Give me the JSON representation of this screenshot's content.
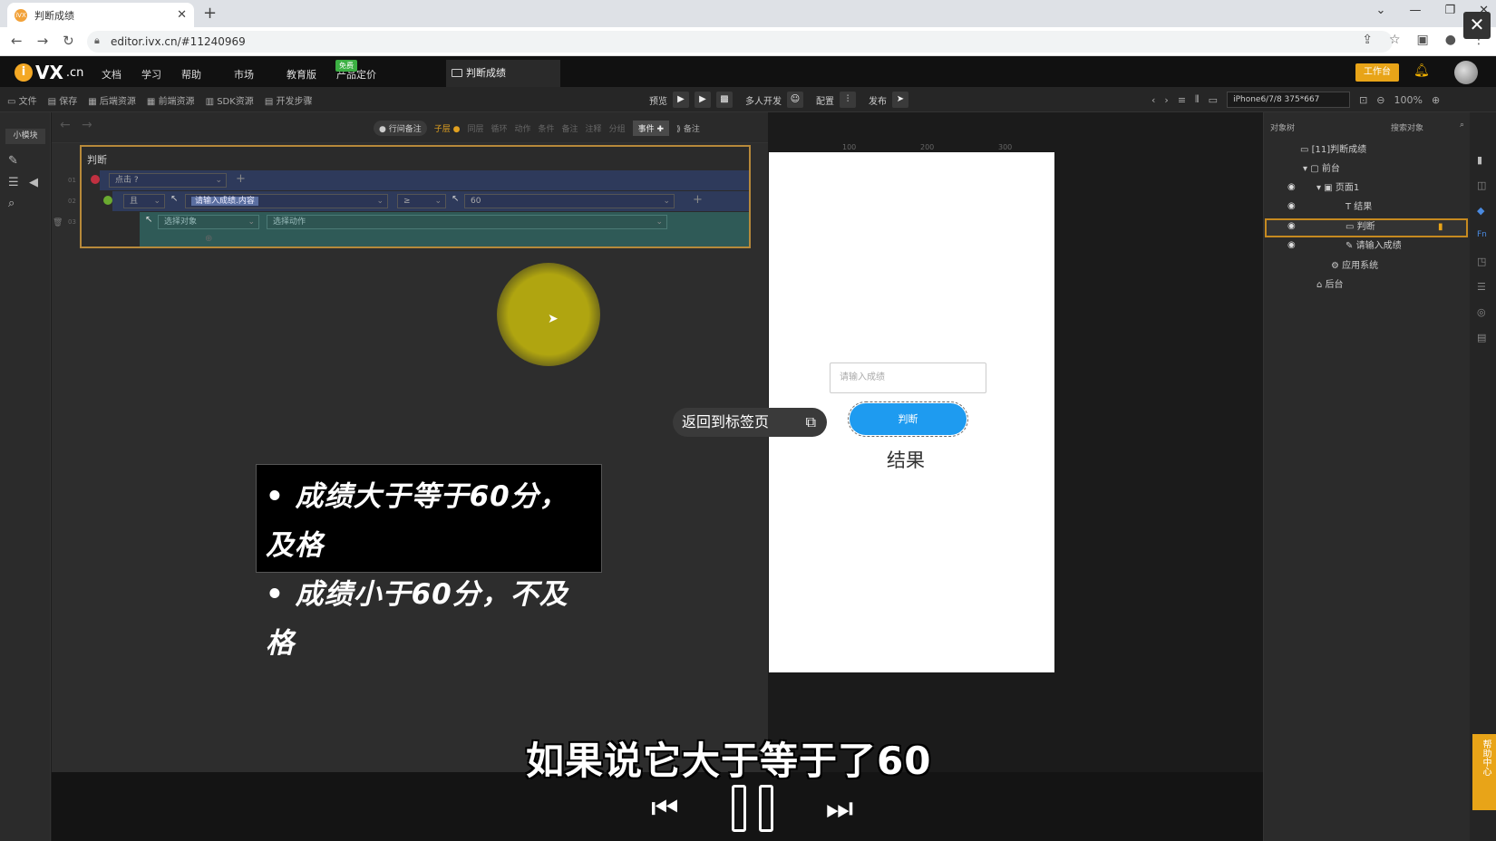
{
  "browser": {
    "tab_title": "判断成绩",
    "url": "editor.ivx.cn/#11240969"
  },
  "app": {
    "logo": "VX",
    "logo_suffix": ".cn",
    "menu": [
      "文档",
      "学习",
      "帮助",
      "市场",
      "教育版",
      "产品定价"
    ],
    "free_badge": "免费",
    "editor_tab": "判断成绩",
    "workbench": "工作台"
  },
  "toolbar": {
    "left": [
      "文件",
      "保存",
      "后端资源",
      "前端资源",
      "SDK资源",
      "开发步骤"
    ],
    "preview": "预览",
    "multi": "多人开发",
    "config": "配置",
    "publish": "发布",
    "device": "iPhone6/7/8 375*667",
    "zoom": "100%"
  },
  "left_sidebar": {
    "module_label": "小模块"
  },
  "logic": {
    "toolbar": {
      "row_note": "行间备注",
      "child": "子层",
      "sibling": "同层",
      "items": [
        "循环",
        "动作",
        "条件",
        "备注",
        "注释",
        "分组"
      ],
      "event": "事件",
      "note": "备注"
    },
    "block_title": "判断",
    "event_trigger": "点击",
    "cond_op_logic": "且",
    "cond_target": "请输入成绩.内容",
    "cond_op": "≥",
    "cond_value": "60",
    "action_target_placeholder": "选择对象",
    "action_placeholder": "选择动作",
    "row_nums": [
      "01",
      "02",
      "03"
    ]
  },
  "notes": {
    "line1": "• 成绩大于等于60分，及格",
    "line2": "• 成绩小于60分，不及格"
  },
  "preview": {
    "ruler": [
      "100",
      "200",
      "300"
    ],
    "input_placeholder": "请输入成绩",
    "button_label": "判断",
    "result_label": "结果",
    "back_to_tab": "返回到标签页"
  },
  "object_tree": {
    "tabs": [
      "对象树",
      "搜索对象"
    ],
    "nodes": [
      {
        "label": "[11]判断成绩",
        "icon": "app-icon"
      },
      {
        "label": "前台",
        "icon": "frontend-icon"
      },
      {
        "label": "页面1",
        "icon": "page-icon"
      },
      {
        "label": "结果",
        "icon": "text-icon"
      },
      {
        "label": "判断",
        "icon": "button-icon"
      },
      {
        "label": "请输入成绩",
        "icon": "input-icon"
      },
      {
        "label": "应用系统",
        "icon": "gear-icon"
      },
      {
        "label": "后台",
        "icon": "backend-icon"
      }
    ]
  },
  "help_side": "帮助中心",
  "video": {
    "subtitle": "如果说它大于等于了60"
  },
  "colors": {
    "accent": "#e8a418",
    "button_blue": "#1e9bf0",
    "block_border": "#b7893a"
  }
}
